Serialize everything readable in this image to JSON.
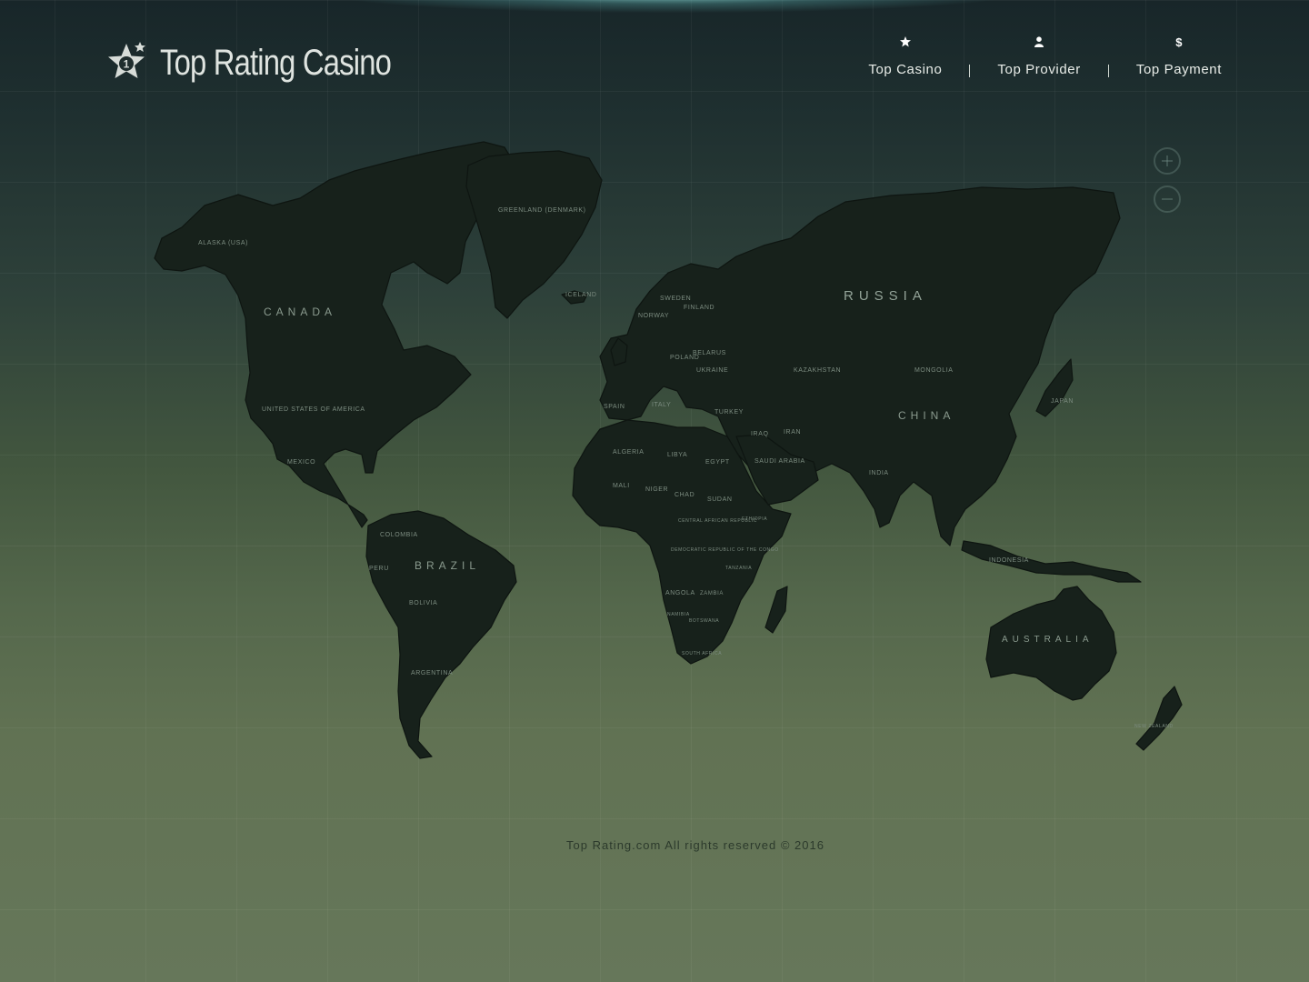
{
  "header": {
    "logo": {
      "badge_number": "1",
      "title": "Top Rating Casino"
    },
    "nav": [
      {
        "icon": "star-icon",
        "label": "Top Casino"
      },
      {
        "icon": "user-icon",
        "label": "Top Provider"
      },
      {
        "icon": "dollar-icon",
        "label": "Top Payment"
      }
    ]
  },
  "map": {
    "zoom_controls": [
      "zoom-in",
      "zoom-out"
    ],
    "labels": {
      "alaska": "ALASKA (USA)",
      "greenland": "GREENLAND (DENMARK)",
      "canada": "CANADA",
      "usa": "UNITED STATES OF AMERICA",
      "mexico": "MEXICO",
      "colombia": "COLOMBIA",
      "peru": "PERU",
      "brazil": "BRAZIL",
      "bolivia": "BOLIVIA",
      "argentina": "ARGENTINA",
      "iceland": "ICELAND",
      "norway": "NORWAY",
      "sweden": "SWEDEN",
      "finland": "FINLAND",
      "spain": "SPAIN",
      "italy": "ITALY",
      "poland": "POLAND",
      "belarus": "BELARUS",
      "ukraine": "UKRAINE",
      "turkey": "TURKEY",
      "algeria": "ALGERIA",
      "libya": "LIBYA",
      "egypt": "EGYPT",
      "mali": "MALI",
      "niger": "NIGER",
      "chad": "CHAD",
      "sudan": "SUDAN",
      "car": "CENTRAL AFRICAN REPUBLIC",
      "ethiopia": "ETHIOPIA",
      "drc": "DEMOCRATIC REPUBLIC OF THE CONGO",
      "tanzania": "TANZANIA",
      "angola": "ANGOLA",
      "zambia": "ZAMBIA",
      "namibia": "NAMIBIA",
      "botswana": "BOTSWANA",
      "south_africa": "SOUTH AFRICA",
      "saudi_arabia": "SAUDI ARABIA",
      "iraq": "IRAQ",
      "iran": "IRAN",
      "russia": "RUSSIA",
      "kazakhstan": "KAZAKHSTAN",
      "mongolia": "MONGOLIA",
      "china": "CHINA",
      "india": "INDIA",
      "japan": "JAPAN",
      "indonesia": "INDONESIA",
      "australia": "AUSTRALIA",
      "new_zealand": "NEW ZEALAND"
    }
  },
  "footer": {
    "text": "Top Rating.com All rights reserved © 2016"
  },
  "colors": {
    "background_top": "#182629",
    "background_bottom": "#66775a",
    "land": "#17211b",
    "nav_text": "#e8ece8",
    "footer_text": "#2c3a2c"
  }
}
